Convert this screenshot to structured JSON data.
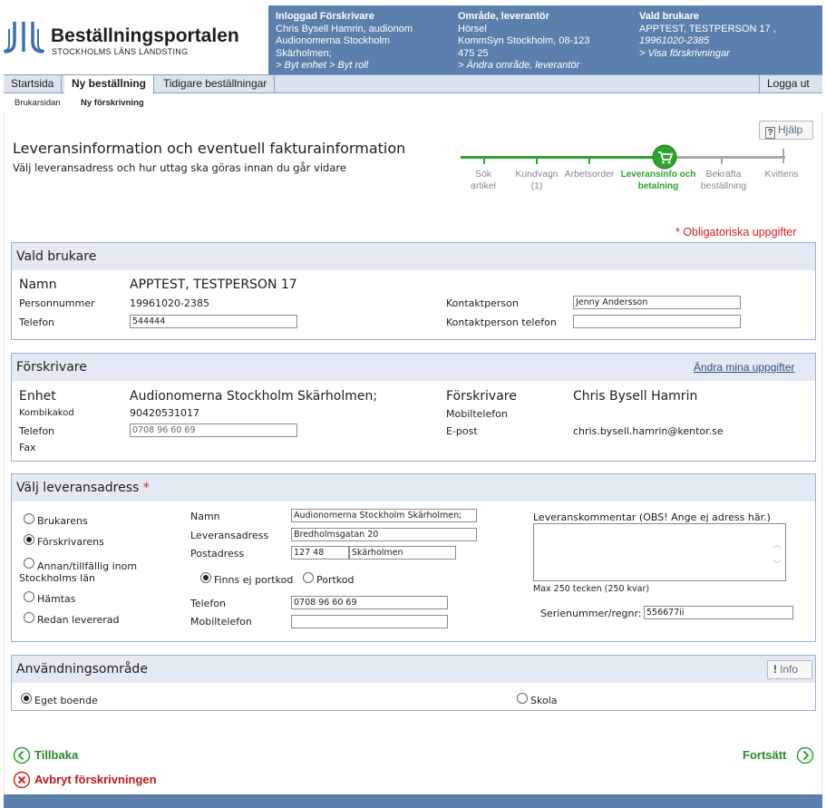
{
  "logo": {
    "title": "Beställningsportalen",
    "subtitle": "STOCKHOLMS LÄNS LANDSTING"
  },
  "infobar": {
    "col1": {
      "heading": "Inloggad Förskrivare",
      "lines": [
        "Chris Bysell Hamrin, audionom",
        "Audionomerna Stockholm",
        "Skärholmen;"
      ],
      "link": "> Byt enhet > Byt roll"
    },
    "col2": {
      "heading": "Område, leverantör",
      "lines": [
        "Hörsel",
        "KommSyn Stockholm, 08-123",
        "475 25"
      ],
      "link": "> Ändra område, leverantör"
    },
    "col3": {
      "heading": "Vald brukare",
      "lines": [
        "APPTEST, TESTPERSON 17 ,"
      ],
      "italic": "19961020-2385",
      "link": "> Visa förskrivningar"
    }
  },
  "nav": {
    "tabs": [
      "Startsida",
      "Ny beställning",
      "Tidigare beställningar"
    ],
    "logout": "Logga ut"
  },
  "subnav": {
    "items": [
      "Brukarsidan",
      "Ny förskrivning"
    ]
  },
  "help": {
    "label": "Hjälp"
  },
  "page": {
    "title": "Leveransinformation och eventuell fakturainformation",
    "subtitle": "Välj leveransadress och hur uttag ska göras innan du går vidare",
    "required_note": "* Obligatoriska uppgifter"
  },
  "steps": [
    {
      "label1": "Sök",
      "label2": "artikel"
    },
    {
      "label1": "Kundvagn",
      "label2": "(1)"
    },
    {
      "label1": "Arbetsorder",
      "label2": ""
    },
    {
      "label1": "Leveransinfo och",
      "label2": "betalning"
    },
    {
      "label1": "Bekräfta",
      "label2": "beställning"
    },
    {
      "label1": "Kvittens",
      "label2": ""
    }
  ],
  "colors": {
    "accent": "#5b80ad",
    "step_done": "#2ea22e",
    "step_pending": "#a8a8a8",
    "required": "#d32020",
    "nav_bg": "#dbe3ee"
  },
  "vald_brukare": {
    "heading": "Vald brukare",
    "name_label": "Namn",
    "name": "APPTEST, TESTPERSON 17",
    "pnr_label": "Personnummer",
    "pnr": "19961020-2385",
    "phone_label": "Telefon",
    "phone": "544444",
    "contact_label": "Kontaktperson",
    "contact": "Jenny Andersson",
    "contact_phone_label": "Kontaktperson telefon",
    "contact_phone": ""
  },
  "forskrivare": {
    "heading": "Förskrivare",
    "edit_link": "Ändra mina uppgifter",
    "unit_label": "Enhet",
    "unit": "Audionomerna Stockholm Skärholmen;",
    "kombika_label": "Kombikakod",
    "kombika": "90420531017",
    "phone_label": "Telefon",
    "phone": "0708 96 60 69",
    "fax_label": "Fax",
    "prescriber_label": "Förskrivare",
    "prescriber": "Chris Bysell Hamrin",
    "mobile_label": "Mobiltelefon",
    "email_label": "E-post",
    "email": "chris.bysell.hamrin@kentor.se"
  },
  "leverans": {
    "heading": "Välj leveransadress",
    "required_mark": "*",
    "options": [
      "Brukarens",
      "Förskrivarens",
      "Annan/tillfällig inom",
      "Stockholms län",
      "Hämtas",
      "Redan levererad"
    ],
    "selected": "Förskrivarens",
    "name_label": "Namn",
    "name": "Audionomerna Stockholm Skärholmen;",
    "address_label": "Leveransadress",
    "address": "Bredholmsgatan 20",
    "postal_label": "Postadress",
    "zip": "127 48",
    "city": "Skärholmen",
    "portcode_none": "Finns ej portkod",
    "portcode": "Portkod",
    "phone_label": "Telefon",
    "phone": "0708 96 60 69",
    "mobile_label": "Mobiltelefon",
    "mobile": "",
    "comment_label": "Leveranskommentar (OBS! Ange ej adress här.)",
    "comment_limit": "Max 250 tecken (250 kvar)",
    "serial_label": "Serienummer/regnr:",
    "serial": "556677ii"
  },
  "anvandning": {
    "heading": "Användningsområde",
    "info": "Info",
    "option1": "Eget boende",
    "option2": "Skola",
    "selected": "Eget boende"
  },
  "actions": {
    "back": "Tillbaka",
    "next": "Fortsätt",
    "cancel": "Avbryt förskrivningen"
  }
}
